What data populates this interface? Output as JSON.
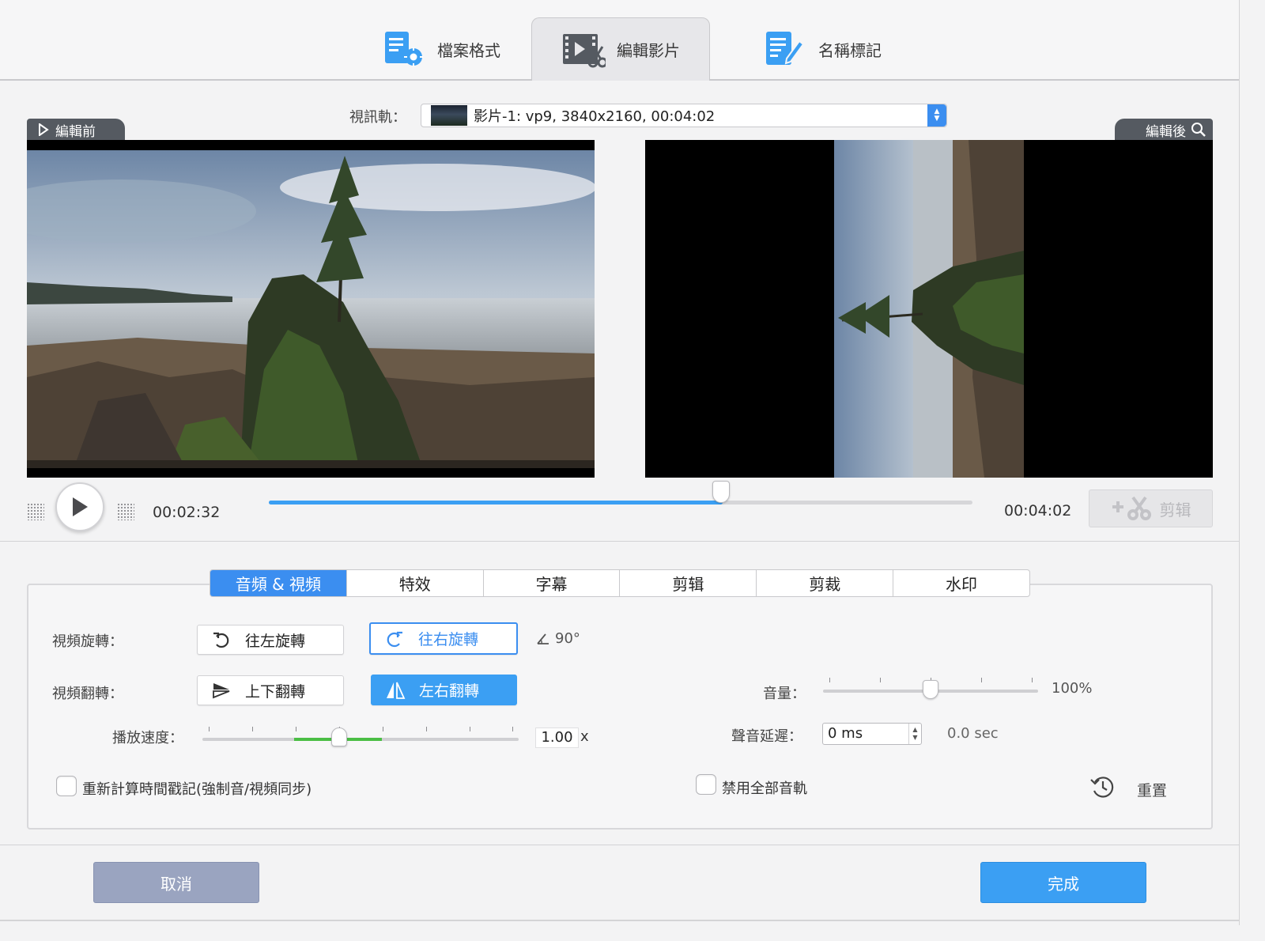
{
  "top_tabs": [
    {
      "label": "檔案格式",
      "icon": "file-settings-icon"
    },
    {
      "label": "編輯影片",
      "icon": "video-edit-icon"
    },
    {
      "label": "名稱標記",
      "icon": "tag-edit-icon"
    }
  ],
  "track": {
    "label": "視訊軌：",
    "selected": "影片-1: vp9, 3840x2160, 00:04:02"
  },
  "preview": {
    "before_label": "編輯前",
    "after_label": "編輯後"
  },
  "playback": {
    "current_time": "00:02:32",
    "total_time": "00:04:02",
    "progress": 0.645,
    "trim_label": "剪辑"
  },
  "sub_tabs": [
    "音頻 & 視頻",
    "特效",
    "字幕",
    "剪辑",
    "剪裁",
    "水印"
  ],
  "rotation": {
    "label": "視頻旋轉：",
    "left_label": "往左旋轉",
    "right_label": "往右旋轉",
    "angle": "90°"
  },
  "flip": {
    "label": "視頻翻轉：",
    "vertical_label": "上下翻轉",
    "horizontal_label": "左右翻轉"
  },
  "speed": {
    "label": "播放速度：",
    "value": "1.00",
    "unit": "x"
  },
  "volume": {
    "label": "音量：",
    "value": "100%",
    "level": 0.5
  },
  "audio_delay": {
    "label": "聲音延遲：",
    "value": "0 ms",
    "seconds": "0.0 sec"
  },
  "options": {
    "recalc_timestamps": "重新計算時間戳記(強制音/視頻同步)",
    "disable_audio": "禁用全部音軌",
    "reset": "重置"
  },
  "footer": {
    "cancel": "取消",
    "done": "完成"
  },
  "colors": {
    "accent": "#3b9ff3",
    "selected_tab": "#3b8ef0",
    "speed_fill": "#4bbe45",
    "cancel_bg": "#9aa4c0"
  }
}
